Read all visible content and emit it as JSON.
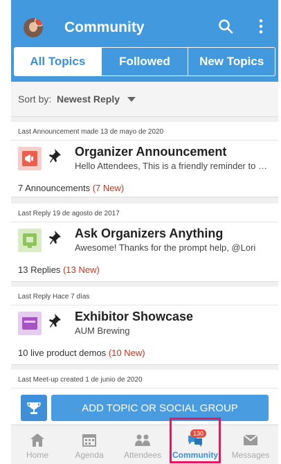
{
  "header": {
    "title": "Community"
  },
  "tabs": [
    {
      "label": "All Topics",
      "active": true
    },
    {
      "label": "Followed",
      "active": false
    },
    {
      "label": "New Topics",
      "active": false
    }
  ],
  "sort": {
    "label": "Sort by:",
    "value": "Newest Reply"
  },
  "topics": [
    {
      "meta": "Last Announcement made 13 de mayo de 2020",
      "title": "Organizer Announcement",
      "preview": "Hello Attendees, This is a friendly reminder to check in",
      "count_text": "7 Announcements",
      "new_text": "(7 New)",
      "icon": "megaphone-icon",
      "icon_color": "#e9604f"
    },
    {
      "meta": "Last Reply 19 de agosto de 2017",
      "title": "Ask Organizers Anything",
      "preview": "Awesome! Thanks for the prompt help, @Lori",
      "count_text": "13 Replies",
      "new_text": "(13 New)",
      "icon": "qa-board-icon",
      "icon_color": "#8fc45a"
    },
    {
      "meta": "Last Reply Hace 7 días",
      "title": "Exhibitor Showcase",
      "preview": "AUM Brewing",
      "count_text": "10 live product demos",
      "new_text": "(10 New)",
      "icon": "storefront-icon",
      "icon_color": "#a653c4"
    },
    {
      "meta": "Last Meet-up created 1 de junio de 2020",
      "title": "",
      "preview": "",
      "count_text": "",
      "new_text": "",
      "icon": "",
      "icon_color": ""
    }
  ],
  "add_button": {
    "label": "ADD TOPIC OR SOCIAL GROUP"
  },
  "bottom_nav": [
    {
      "label": "Home",
      "icon": "home-icon",
      "active": false
    },
    {
      "label": "Agenda",
      "icon": "calendar-icon",
      "active": false
    },
    {
      "label": "Attendees",
      "icon": "people-icon",
      "active": false
    },
    {
      "label": "Community",
      "icon": "chat-bubbles-icon",
      "active": true,
      "badge": "130"
    },
    {
      "label": "Messages",
      "icon": "envelope-icon",
      "active": false
    }
  ],
  "colors": {
    "accent": "#4299de",
    "new_count": "#d0311f",
    "highlight": "#e6175c"
  }
}
